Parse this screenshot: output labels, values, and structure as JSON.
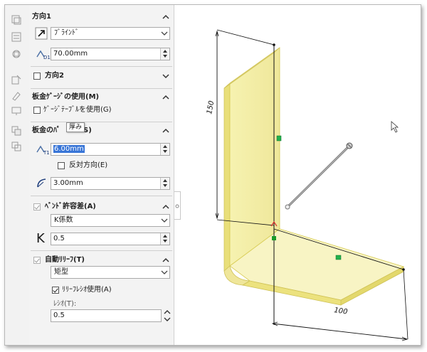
{
  "direction1": {
    "title": "方向1",
    "end_condition": "ﾌﾞﾗｲﾝﾄﾞ",
    "depth_value": "70.00mm"
  },
  "direction2": {
    "title": "方向2"
  },
  "gauge": {
    "title": "板金ｹﾞｰｼﾞの使用(M)",
    "table_checkbox": "ｹﾞｰｼﾞﾃｰﾌﾞﾙを使用(G)"
  },
  "params": {
    "title": "板金のﾊﾟ",
    "title_suffix": "S)",
    "tooltip": "厚み",
    "thickness_value": "6.00mm",
    "reverse_checkbox": "反対方向(E)",
    "radius_value": "3.00mm"
  },
  "bend_allowance": {
    "title": "ﾍﾞﾝﾄﾞ許容差(A)",
    "type": "K係数",
    "k_symbol": "K",
    "k_value": "0.5"
  },
  "relief": {
    "title": "自動ﾘﾘｰﾌ(T)",
    "type": "矩型",
    "ratio_checkbox": "ﾘﾘｰﾌﾚｼｵ使用(A)",
    "ratio_label": "ﾚｼｵ(T):",
    "ratio_value": "0.5"
  },
  "model": {
    "dim_vertical": "150",
    "dim_horizontal": "100",
    "part_color": "#f5f0a0",
    "part_edge_color": "#d8cc55"
  }
}
